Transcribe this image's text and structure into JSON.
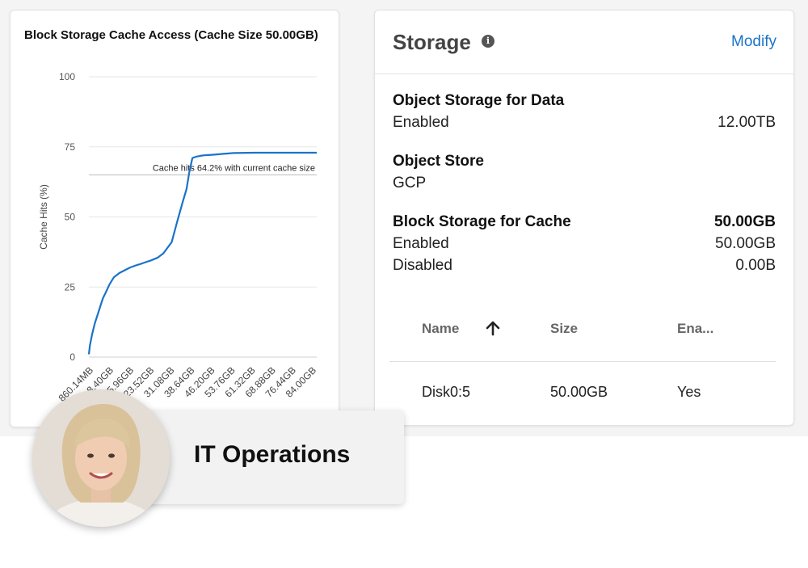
{
  "chart_card": {
    "title": "Block Storage Cache Access (Cache Size 50.00GB)"
  },
  "chart_data": {
    "type": "line",
    "title": "Block Storage Cache Access (Cache Size 50.00GB)",
    "xlabel": "",
    "ylabel": "Cache Hits (%)",
    "ylim": [
      0,
      100
    ],
    "yticks": [
      0,
      25,
      50,
      75,
      100
    ],
    "categories": [
      "860.14MB",
      "8.40GB",
      "15.96GB",
      "23.52GB",
      "31.08GB",
      "38.64GB",
      "46.20GB",
      "53.76GB",
      "61.32GB",
      "68.88GB",
      "76.44GB",
      "84.00GB"
    ],
    "series": [
      {
        "color": "#1a73c8",
        "x": [
          0.86,
          1.2,
          2,
          3,
          4,
          5,
          6,
          7,
          8.4,
          10,
          12,
          14,
          15.96,
          18,
          20,
          22,
          23.52,
          26,
          28,
          31.08,
          33,
          35,
          36.5,
          37.5,
          38.64,
          40,
          41.5,
          43,
          46.2,
          50,
          53.76,
          61.32,
          68.88,
          76.44,
          84.0
        ],
        "y": [
          1,
          4,
          8,
          12,
          15,
          18,
          21,
          23,
          26,
          28.5,
          30,
          31,
          32,
          32.7,
          33.3,
          34,
          34.5,
          35.5,
          37,
          41,
          48,
          55,
          60,
          66,
          71,
          71.5,
          71.8,
          72,
          72.2,
          72.5,
          72.8,
          72.9,
          72.9,
          72.9,
          72.9
        ]
      }
    ],
    "annotation": "Cache hits 64.2% with current cache size",
    "annotation_y": 65,
    "grid": true
  },
  "storage": {
    "title": "Storage",
    "info_icon": "info-icon",
    "modify_label": "Modify",
    "object_storage_label": "Object Storage for Data",
    "object_storage_status": "Enabled",
    "object_storage_size": "12.00TB",
    "object_store_label": "Object Store",
    "object_store_value": "GCP",
    "block_label": "Block Storage for Cache",
    "block_total": "50.00GB",
    "block_enabled_label": "Enabled",
    "block_enabled_value": "50.00GB",
    "block_disabled_label": "Disabled",
    "block_disabled_value": "0.00B",
    "table": {
      "headers": [
        "Name",
        "Size",
        "Ena..."
      ],
      "sort_icon": "arrow-up-icon",
      "rows": [
        [
          "Disk0:5",
          "50.00GB",
          "Yes"
        ]
      ]
    }
  },
  "persona": {
    "label": "IT Operations",
    "avatar_icon": "avatar"
  }
}
